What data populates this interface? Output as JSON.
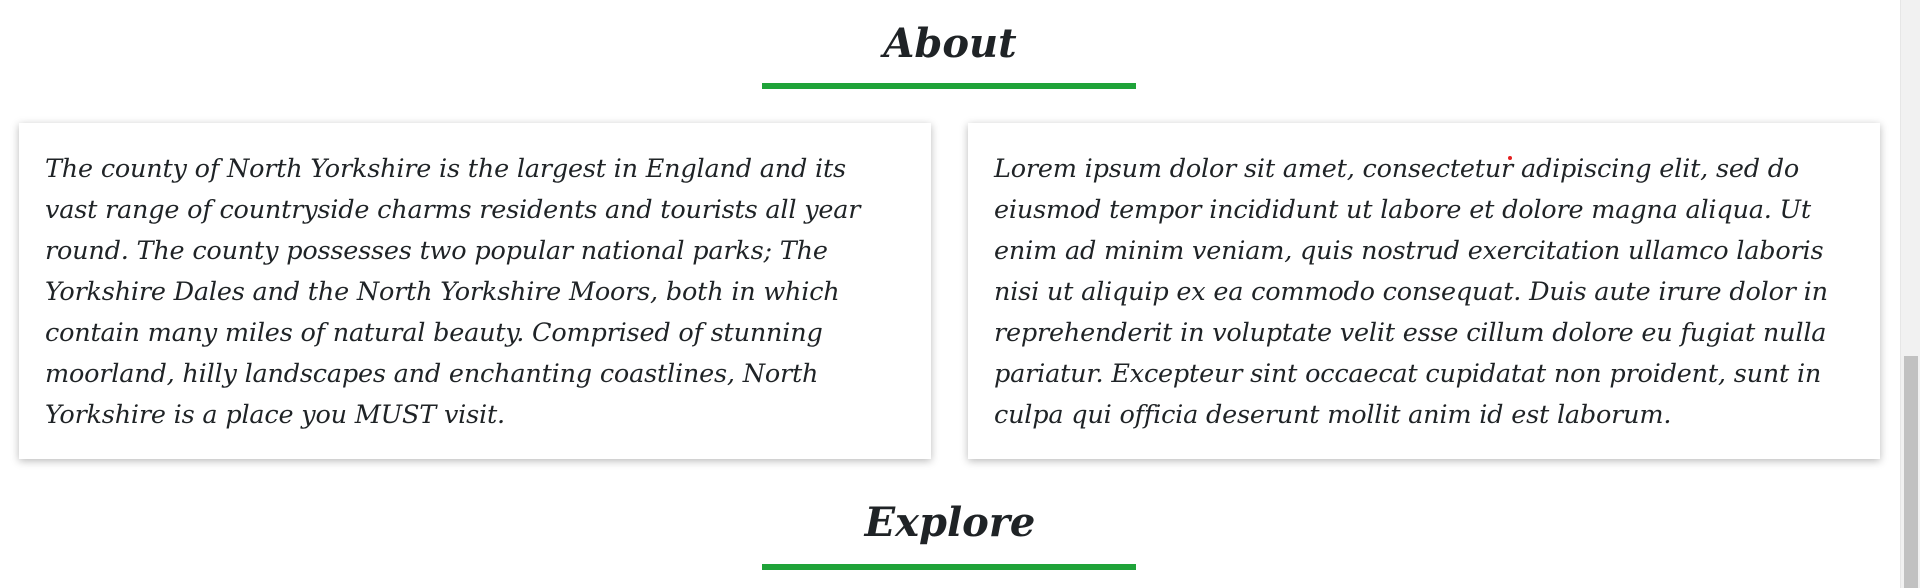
{
  "about": {
    "heading": "About",
    "left_card_text": "The county of North Yorkshire is the largest in England and its vast range of countryside charms residents and tourists all year round. The county possesses two popular national parks; The Yorkshire Dales and the North Yorkshire Moors, both in which contain many miles of natural beauty. Comprised of stunning moorland, hilly landscapes and enchanting coastlines, North Yorkshire is a place you MUST visit.",
    "right_card_text": "Lorem ipsum dolor sit amet, consectetur adipiscing elit, sed do eiusmod tempor incididunt ut labore et dolore magna aliqua. Ut enim ad minim veniam, quis nostrud exercitation ullamco laboris nisi ut aliquip ex ea commodo consequat. Duis aute irure dolor in reprehenderit in voluptate velit esse cillum dolore eu fugiat nulla pariatur. Excepteur sint occaecat cupidatat non proident, sunt in culpa qui officia deserunt mollit anim id est laborum."
  },
  "explore": {
    "heading": "Explore"
  },
  "colors": {
    "accent": "#1fa339",
    "text": "#1f2326",
    "background": "#ffffff"
  }
}
